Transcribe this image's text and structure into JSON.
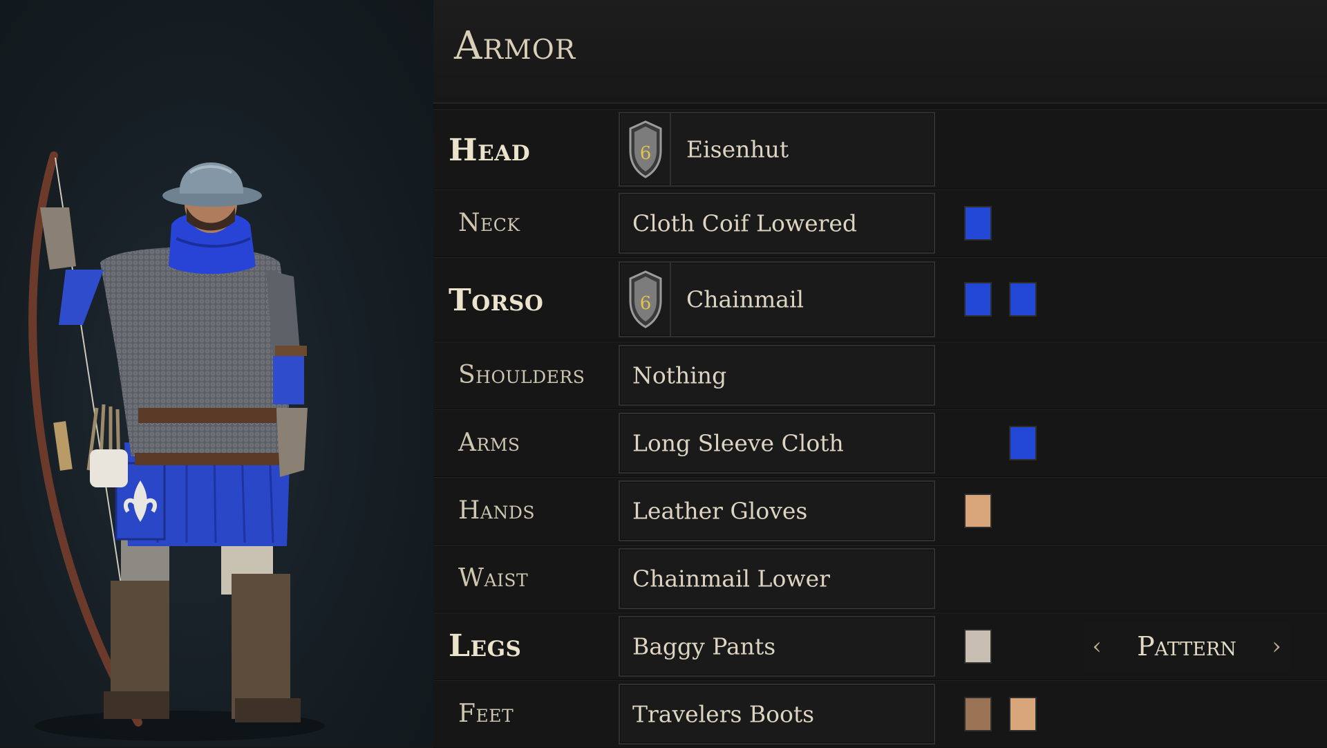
{
  "panel": {
    "title": "Armor"
  },
  "rows": [
    {
      "label": "Head",
      "major": true,
      "item": "Eisenhut",
      "tier": "6",
      "swatches": [],
      "swatch_cols": []
    },
    {
      "label": "Neck",
      "major": false,
      "item": "Cloth Coif Lowered",
      "swatches": [
        "#2448d6"
      ],
      "swatch_cols": [
        0
      ]
    },
    {
      "label": "Torso",
      "major": true,
      "item": "Chainmail",
      "tier": "6",
      "swatches": [
        "#2448d6",
        "#2448d6"
      ],
      "swatch_cols": [
        0,
        1
      ]
    },
    {
      "label": "Shoulders",
      "major": false,
      "item": "Nothing",
      "swatches": [],
      "swatch_cols": []
    },
    {
      "label": "Arms",
      "major": false,
      "item": "Long Sleeve Cloth",
      "swatches": [
        "#2448d6"
      ],
      "swatch_cols": [
        1
      ]
    },
    {
      "label": "Hands",
      "major": false,
      "item": "Leather Gloves",
      "swatches": [
        "#d8a67a"
      ],
      "swatch_cols": [
        0
      ]
    },
    {
      "label": "Waist",
      "major": false,
      "item": "Chainmail Lower",
      "swatches": [],
      "swatch_cols": []
    },
    {
      "label": "Legs",
      "major": true,
      "item": "Baggy Pants",
      "swatches": [
        "#c9beb2"
      ],
      "swatch_cols": [
        0
      ]
    },
    {
      "label": "Feet",
      "major": false,
      "item": "Travelers Boots",
      "swatches": [
        "#9a7254",
        "#d8a67a"
      ],
      "swatch_cols": [
        0,
        1
      ]
    }
  ],
  "pattern": {
    "label": "Pattern",
    "prev_icon": "chevron-left-icon",
    "next_icon": "chevron-right-icon"
  },
  "character": {
    "icon": "archer-character-model"
  },
  "colors": {
    "accent_text": "#d9cfb8",
    "team_blue": "#2448d6"
  }
}
